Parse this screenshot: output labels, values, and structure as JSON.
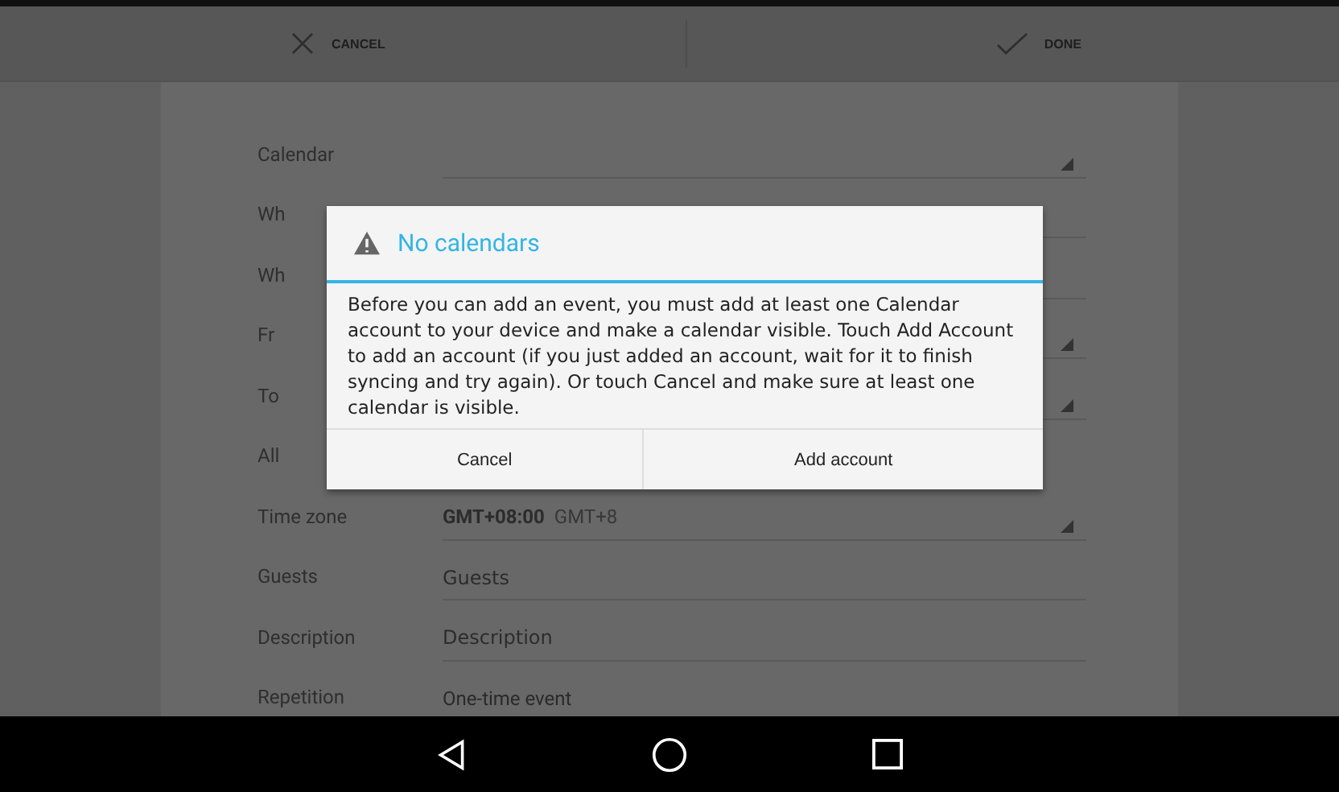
{
  "action_bar": {
    "cancel": "CANCEL",
    "done": "DONE"
  },
  "form": {
    "rows": [
      {
        "label": "Calendar",
        "kind": "spinner"
      },
      {
        "label": "Wh",
        "kind": "input"
      },
      {
        "label": "Wh",
        "kind": "input"
      },
      {
        "label": "Fr",
        "kind": "spinner"
      },
      {
        "label": "To",
        "kind": "spinner"
      },
      {
        "label": "All",
        "kind": "blank"
      },
      {
        "label": "Time zone",
        "kind": "spinner",
        "value": "GMT+08:00",
        "secondary": "GMT+8"
      },
      {
        "label": "Guests",
        "kind": "input",
        "placeholder": "Guests"
      },
      {
        "label": "Description",
        "kind": "input",
        "placeholder": "Description"
      },
      {
        "label": "Repetition",
        "kind": "text",
        "value": "One-time event"
      }
    ]
  },
  "dialog": {
    "title": "No calendars",
    "message": "Before you can add an event, you must add at least one Calendar account to your device and make a calendar visible. Touch Add Account to add an account (if you just added an account, wait for it to finish syncing and try again). Or touch Cancel and make sure at least one calendar is visible.",
    "buttons": [
      "Cancel",
      "Add account"
    ]
  }
}
